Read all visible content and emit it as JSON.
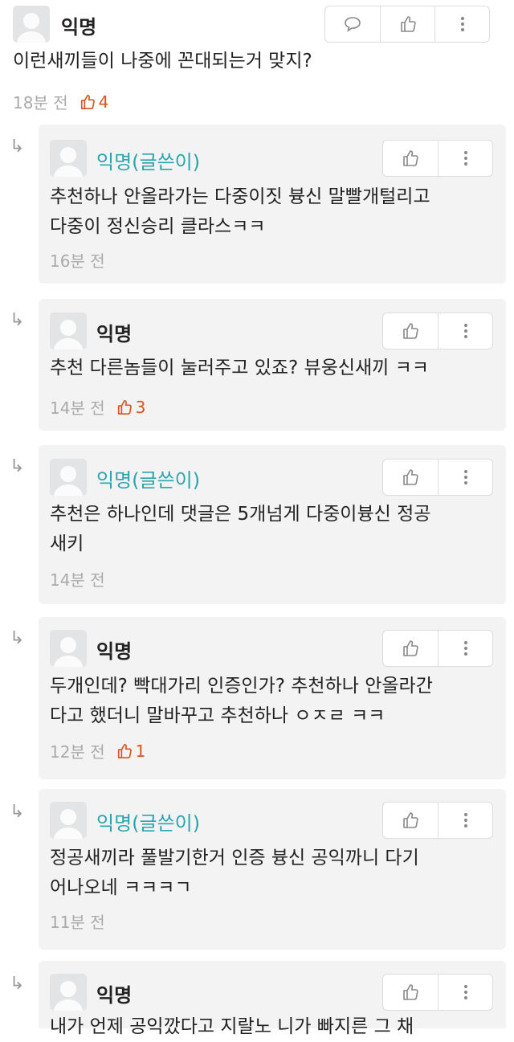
{
  "top": {
    "name": "익명",
    "text": "이런새끼들이 나중에 꼰대되는거 맞지?",
    "time": "18분 전",
    "likes": "4"
  },
  "reply_arrow": "↳",
  "replies": [
    {
      "name": "익명(글쓴이)",
      "author": true,
      "lines": [
        "추천하나 안올라가는 다중이짓 븅신 말빨개털리고",
        "다중이 정신승리 클라스ㅋㅋ"
      ],
      "time": "16분 전",
      "likes": ""
    },
    {
      "name": "익명",
      "author": false,
      "lines": [
        "추천 다른놈들이 눌러주고 있죠? 뷰웅신새끼 ㅋㅋ"
      ],
      "time": "14분 전",
      "likes": "3"
    },
    {
      "name": "익명(글쓴이)",
      "author": true,
      "lines": [
        "추천은 하나인데 댓글은 5개넘게 다중이븅신 정공",
        "새키"
      ],
      "time": "14분 전",
      "likes": ""
    },
    {
      "name": "익명",
      "author": false,
      "lines": [
        "두개인데? 빡대가리 인증인가? 추천하나 안올라간",
        "다고 했더니 말바꾸고 추천하나 ㅇㅈㄹ ㅋㅋ"
      ],
      "time": "12분 전",
      "likes": "1"
    },
    {
      "name": "익명(글쓴이)",
      "author": true,
      "lines": [
        "정공새끼라 풀발기한거 인증 븅신 공익까니 다기",
        "어나오네 ㅋㅋㅋㄱ"
      ],
      "time": "11분 전",
      "likes": ""
    },
    {
      "name": "익명",
      "author": false,
      "lines": [
        "내가 언제 공익깠다고 지랄노 니가 빠지른 그 채"
      ],
      "time": "",
      "likes": ""
    }
  ]
}
